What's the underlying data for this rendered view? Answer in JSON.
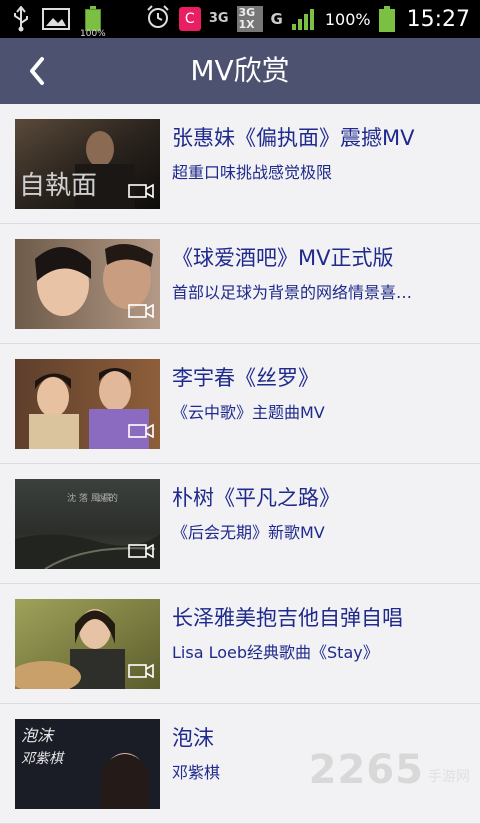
{
  "status_bar": {
    "battery_small_label": "100%",
    "notification_badge": "C",
    "network_3g": "3G",
    "network_3g_1x": "3G 1X",
    "network_g": "G",
    "battery_percent": "100%",
    "time": "15:27",
    "battery_color": "#7bc043"
  },
  "header": {
    "title": "MV欣赏",
    "background": "#4d5270"
  },
  "videos": [
    {
      "title": "张惠妹《偏执面》震撼MV",
      "subtitle": "超重口味挑战感觉极限"
    },
    {
      "title": "《球爱酒吧》MV正式版",
      "subtitle": "首部以足球为背景的网络情景喜…"
    },
    {
      "title": "李宇春《丝罗》",
      "subtitle": "《云中歌》主题曲MV"
    },
    {
      "title": "朴树《平凡之路》",
      "subtitle": "《后会无期》新歌MV"
    },
    {
      "title": "长泽雅美抱吉他自弹自唱",
      "subtitle": "Lisa Loeb经典歌曲《Stay》"
    },
    {
      "title": "泡沫",
      "subtitle": "邓紫棋"
    }
  ],
  "watermark": {
    "number": "2265",
    "site": "手游网"
  },
  "colors": {
    "title_text": "#1f2a8c",
    "list_bg": "#f2f2f4"
  }
}
